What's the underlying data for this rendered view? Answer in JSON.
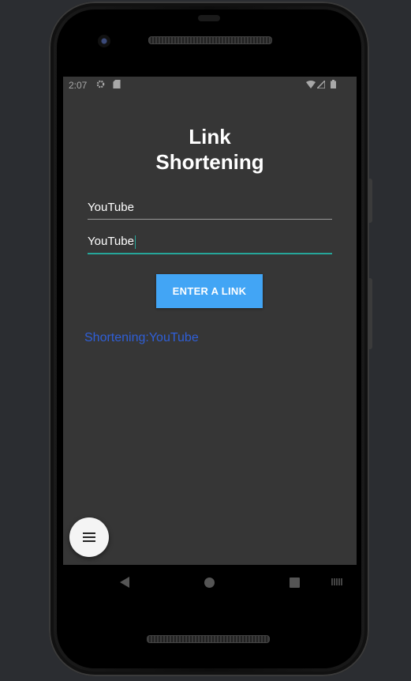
{
  "status_bar": {
    "time": "2:07",
    "icons": [
      "gear-icon",
      "sd-card-icon",
      "wifi-icon",
      "signal-icon",
      "battery-icon"
    ]
  },
  "app": {
    "title_line1": "Link",
    "title_line2": "Shortening",
    "input1": {
      "value": "YouTube"
    },
    "input2": {
      "value": "YouTube"
    },
    "button_label": "ENTER A LINK",
    "result_text": "Shortening:YouTube",
    "fab_icon": "menu-icon"
  },
  "nav_bar": {
    "icons": [
      "back-icon",
      "home-icon",
      "recents-icon",
      "keyboard-icon"
    ]
  },
  "colors": {
    "screen_bg": "#363636",
    "button_bg": "#42a5f5",
    "result_text": "#2f5fd8",
    "focus_underline": "#26a69a"
  }
}
